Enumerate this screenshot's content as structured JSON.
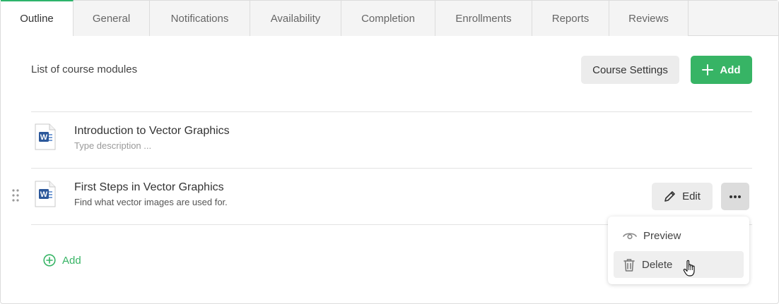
{
  "tabs": [
    {
      "label": "Outline",
      "active": true
    },
    {
      "label": "General"
    },
    {
      "label": "Notifications"
    },
    {
      "label": "Availability"
    },
    {
      "label": "Completion"
    },
    {
      "label": "Enrollments"
    },
    {
      "label": "Reports"
    },
    {
      "label": "Reviews"
    }
  ],
  "header": {
    "title": "List of course modules",
    "settings_label": "Course Settings",
    "add_label": "Add"
  },
  "modules": [
    {
      "title": "Introduction to Vector Graphics",
      "description": "Type description ...",
      "icon": "word-document-icon"
    },
    {
      "title": "First Steps in Vector Graphics",
      "description": "Find what vector images are used for.",
      "icon": "word-document-icon"
    }
  ],
  "actions": {
    "edit_label": "Edit",
    "more_icon": "more-horizontal-icon"
  },
  "add_link": {
    "label": "Add"
  },
  "context_menu": {
    "items": [
      {
        "label": "Preview",
        "icon": "eye-icon"
      },
      {
        "label": "Delete",
        "icon": "trash-icon",
        "hovered": true
      }
    ]
  },
  "colors": {
    "accent": "#37b465",
    "tab_active_border": "#2db46b",
    "word_blue": "#2b579a"
  }
}
